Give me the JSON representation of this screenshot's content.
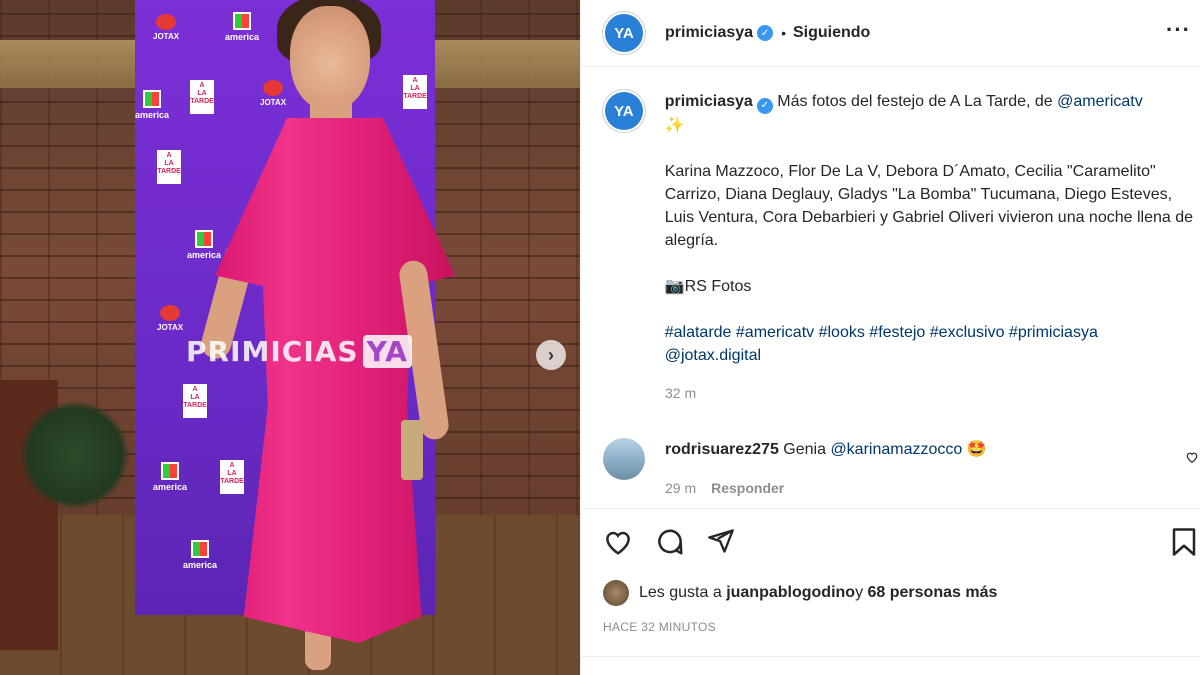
{
  "photo": {
    "watermark_text": "PRIMICIAS",
    "watermark_badge": "YA",
    "next_icon": "chevron-right-icon",
    "banner_logos": [
      "america",
      "JOTAX",
      "A LA TARDE"
    ]
  },
  "header": {
    "avatar_text": "YA",
    "username": "primiciasya",
    "verified_icon": "verified-badge-icon",
    "separator": "•",
    "follow_status": "Siguiendo",
    "more_icon": "more-options-icon"
  },
  "caption": {
    "avatar_text": "YA",
    "username": "primiciasya",
    "line1_text": "Más fotos del festejo de A La Tarde, de ",
    "line1_mention": "@americatv",
    "sparkle": "✨",
    "para2": "Karina Mazzoco, Flor De La V, Debora D´Amato, Cecilia \"Caramelito\" Carrizo, Diana Deglauy, Gladys \"La Bomba\" Tucumana, Diego Esteves, Luis Ventura, Cora Debarbieri y Gabriel Oliveri vivieron una noche llena de alegría.",
    "para3": "📷RS Fotos",
    "hashtags": "#alatarde #americatv #looks #festejo #exclusivo #primiciasya",
    "mention2": "@jotax.digital",
    "time": "32 m"
  },
  "comment": {
    "username": "rodrisuarez275",
    "text": "Genia ",
    "mention": "@karinamazzocco",
    "emoji": "🤩",
    "time": "29 m",
    "reply": "Responder"
  },
  "likes": {
    "prefix": "Les gusta a ",
    "user": "juanpablogodino",
    "middle": " y ",
    "count": "68 personas más"
  },
  "posted_ago": "HACE 32 MINUTOS",
  "colors": {
    "accent_blue": "#3897f0",
    "link": "#00376b",
    "muted": "#8e8e8e",
    "dress_pink": "#e2227b",
    "banner_purple": "#6a2ac7"
  }
}
